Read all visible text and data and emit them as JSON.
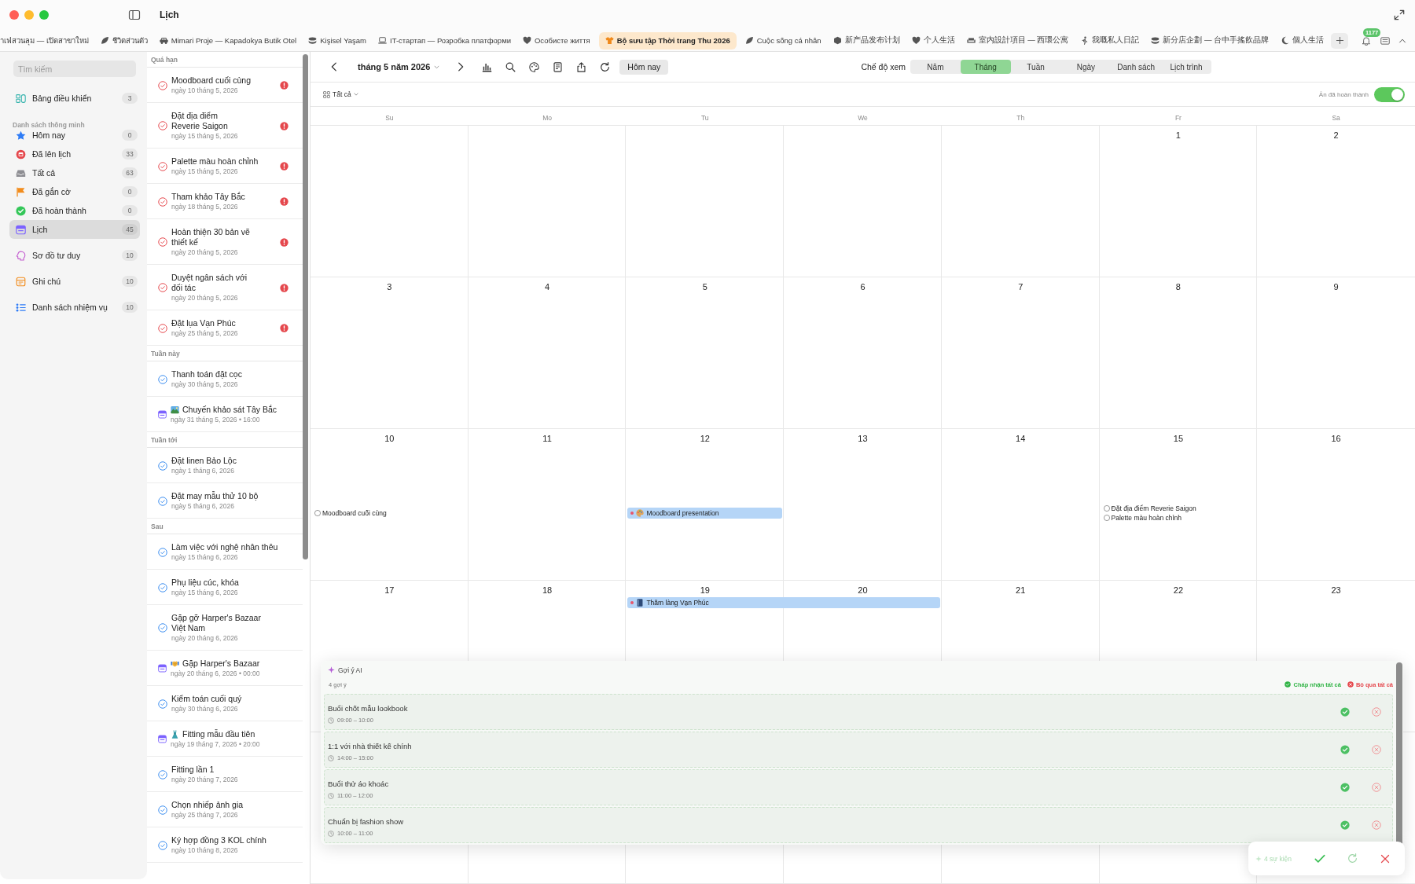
{
  "window": {
    "title": "Lịch"
  },
  "tabs": [
    {
      "label": "าเฟ่สวนลุม — เปิดสาขาใหม่",
      "selected": false
    },
    {
      "label": "ชีวิตส่วนตัว",
      "selected": false
    },
    {
      "label": "Mimari Proje — Kapadokya Butik Otel",
      "selected": false
    },
    {
      "label": "Kişisel Yaşam",
      "selected": false
    },
    {
      "label": "IT-стартап — Розробка платформи",
      "selected": false
    },
    {
      "label": "Особисте життя",
      "selected": false
    },
    {
      "label": "Bộ sưu tập Thời trang Thu 2026",
      "selected": true
    },
    {
      "label": "Cuộc sống cá nhân",
      "selected": false
    },
    {
      "label": "新产品发布计划",
      "selected": false
    },
    {
      "label": "个人生活",
      "selected": false
    },
    {
      "label": "室内設計項目 — 西環公寓",
      "selected": false
    },
    {
      "label": "我嘅私人日記",
      "selected": false
    },
    {
      "label": "新分店企劃 — 台中手搖飲品牌",
      "selected": false
    },
    {
      "label": "個人生活",
      "selected": false
    }
  ],
  "notifications": {
    "badge": "1177"
  },
  "sidebar": {
    "search": {
      "placeholder": "Tìm kiếm"
    },
    "groups": [
      {
        "items": [
          {
            "label": "Bảng điều khiển",
            "count": "3",
            "selected": false
          }
        ]
      },
      {
        "title": "Danh sách thông minh",
        "items": [
          {
            "label": "Hôm nay",
            "count": "0",
            "selected": false
          },
          {
            "label": "Đã lên lịch",
            "count": "33",
            "selected": false
          },
          {
            "label": "Tất cả",
            "count": "63",
            "selected": false
          },
          {
            "label": "Đã gắn cờ",
            "count": "0",
            "selected": false
          },
          {
            "label": "Đã hoàn thành",
            "count": "0",
            "selected": false
          },
          {
            "label": "Lịch",
            "count": "45",
            "selected": true
          }
        ]
      },
      {
        "items": [
          {
            "label": "Sơ đồ tư duy",
            "count": "10",
            "selected": false
          }
        ]
      },
      {
        "items": [
          {
            "label": "Ghi chú",
            "count": "10",
            "selected": false
          }
        ]
      },
      {
        "items": [
          {
            "label": "Danh sách nhiệm vụ",
            "count": "10",
            "selected": false
          }
        ]
      }
    ]
  },
  "task_list": {
    "sections": [
      {
        "title": "Quá hạn",
        "items": [
          {
            "kind": "task",
            "title": "Moodboard cuối cùng",
            "date": "ngày 10 tháng 5, 2026",
            "overdue": true
          },
          {
            "kind": "task",
            "title": "Đặt địa điểm\nReverie Saigon",
            "date": "ngày 15 tháng 5, 2026",
            "overdue": true
          },
          {
            "kind": "task",
            "title": "Palette màu hoàn chỉnh",
            "date": "ngày 15 tháng 5, 2026",
            "overdue": true
          },
          {
            "kind": "task",
            "title": "Tham khảo Tây Bắc",
            "date": "ngày 18 tháng 5, 2026",
            "overdue": true
          },
          {
            "kind": "task",
            "title": "Hoàn thiện 30 bản vẽ\nthiết kế",
            "date": "ngày 20 tháng 5, 2026",
            "overdue": true
          },
          {
            "kind": "task",
            "title": "Duyệt ngân sách với\nđối tác",
            "date": "ngày 20 tháng 5, 2026",
            "overdue": true
          },
          {
            "kind": "task",
            "title": "Đặt lụa Vạn Phúc",
            "date": "ngày 25 tháng 5, 2026",
            "overdue": true
          }
        ]
      },
      {
        "title": "Tuần này",
        "items": [
          {
            "kind": "task",
            "title": "Thanh toán đặt cọc",
            "date": "ngày 30 tháng 5, 2026",
            "overdue": false
          },
          {
            "kind": "event",
            "title": "Chuyến khảo sát Tây Bắc",
            "date": "ngày 31 tháng 5, 2026 • 16:00",
            "overdue": false
          }
        ]
      },
      {
        "title": "Tuần tới",
        "items": [
          {
            "kind": "task",
            "title": "Đặt linen Bảo Lộc",
            "date": "ngày 1 tháng 6, 2026",
            "overdue": false
          },
          {
            "kind": "task",
            "title": "Đặt may mẫu thử 10 bộ",
            "date": "ngày 5 tháng 6, 2026",
            "overdue": false
          }
        ]
      },
      {
        "title": "Sau",
        "items": [
          {
            "kind": "task",
            "title": "Làm việc với nghệ nhân thêu",
            "date": "ngày 15 tháng 6, 2026",
            "overdue": false
          },
          {
            "kind": "task",
            "title": "Phụ liệu cúc, khóa",
            "date": "ngày 15 tháng 6, 2026",
            "overdue": false
          },
          {
            "kind": "task",
            "title": "Gặp gỡ Harper's Bazaar\nViệt Nam",
            "date": "ngày 20 tháng 6, 2026",
            "overdue": false
          },
          {
            "kind": "event",
            "title": "Gặp Harper's Bazaar",
            "date": "ngày 20 tháng 6, 2026 • 00:00",
            "overdue": false
          },
          {
            "kind": "task",
            "title": "Kiểm toán cuối quý",
            "date": "ngày 30 tháng 6, 2026",
            "overdue": false
          },
          {
            "kind": "event",
            "title": "Fitting mẫu đầu tiên",
            "date": "ngày 19 tháng 7, 2026 • 20:00",
            "overdue": false
          },
          {
            "kind": "task",
            "title": "Fitting lần 1",
            "date": "ngày 20 tháng 7, 2026",
            "overdue": false
          },
          {
            "kind": "task",
            "title": "Chọn nhiếp ảnh gia",
            "date": "ngày 25 tháng 7, 2026",
            "overdue": false
          },
          {
            "kind": "task",
            "title": "Ký hợp đồng 3 KOL chính",
            "date": "ngày 10 tháng 8, 2026",
            "overdue": false
          }
        ]
      }
    ]
  },
  "calendar": {
    "month_label": "tháng 5 năm 2026",
    "today_button": "Hôm nay",
    "view_mode": {
      "label": "Chế độ xem",
      "options": [
        {
          "label": "Năm",
          "selected": false
        },
        {
          "label": "Tháng",
          "selected": true
        },
        {
          "label": "Tuần",
          "selected": false
        },
        {
          "label": "Ngày",
          "selected": false
        },
        {
          "label": "Danh sách",
          "selected": false
        },
        {
          "label": "Lịch trình",
          "selected": false
        }
      ]
    },
    "filter": {
      "label": "Tất cả"
    },
    "hide_completed": {
      "label": "Ẩn đã hoàn thành",
      "on": true
    },
    "weekdays": [
      "Su",
      "Mo",
      "Tu",
      "We",
      "Th",
      "Fr",
      "Sa"
    ],
    "weeks": [
      {
        "days": [
          {
            "day": "1"
          },
          {
            "day": "2"
          }
        ]
      },
      {
        "days": [
          {
            "day": "3"
          },
          {
            "day": "4"
          },
          {
            "day": "5"
          },
          {
            "day": "6"
          },
          {
            "day": "7"
          },
          {
            "day": "8"
          },
          {
            "day": "9"
          }
        ]
      },
      {
        "days": [
          {
            "day": "10",
            "items": [
              {
                "kind": "task",
                "title": "Moodboard cuối cùng",
                "checked": false
              }
            ]
          },
          {
            "day": "11"
          },
          {
            "day": "12",
            "items": [
              {
                "kind": "event",
                "title": "Moodboard presentation",
                "spans_next_day": false
              }
            ]
          },
          {
            "day": "13"
          },
          {
            "day": "14"
          },
          {
            "day": "15",
            "items": [
              {
                "kind": "task",
                "title": "Đặt địa điểm Reverie Saigon",
                "checked": false
              },
              {
                "kind": "task",
                "title": "Palette màu hoàn chỉnh",
                "checked": false
              }
            ]
          },
          {
            "day": "16"
          }
        ]
      },
      {
        "days": [
          {
            "day": "17"
          },
          {
            "day": "18"
          },
          {
            "day": "19",
            "items": [
              {
                "kind": "event",
                "title": "Thăm làng Vạn Phúc",
                "spans_next_day": true
              }
            ]
          },
          {
            "day": "20"
          },
          {
            "day": "21"
          },
          {
            "day": "22"
          },
          {
            "day": "23"
          }
        ]
      }
    ]
  },
  "ai_suggestions": {
    "title": "Gợi ý AI",
    "count_label": "4 gợi ý",
    "accept_all": "Chấp nhận tất cả",
    "skip_all": "Bỏ qua tất cả",
    "items": [
      {
        "title": "Buổi chốt mẫu lookbook",
        "time": "09:00 – 10:00"
      },
      {
        "title": "1:1 với nhà thiết kế chính",
        "time": "14:00 – 15:00"
      },
      {
        "title": "Buổi thử áo khoác",
        "time": "11:00 – 12:00"
      },
      {
        "title": "Chuẩn bị fashion show",
        "time": "10:00 – 11:00"
      }
    ]
  },
  "ai_bar": {
    "label": "4 sự kiện"
  }
}
